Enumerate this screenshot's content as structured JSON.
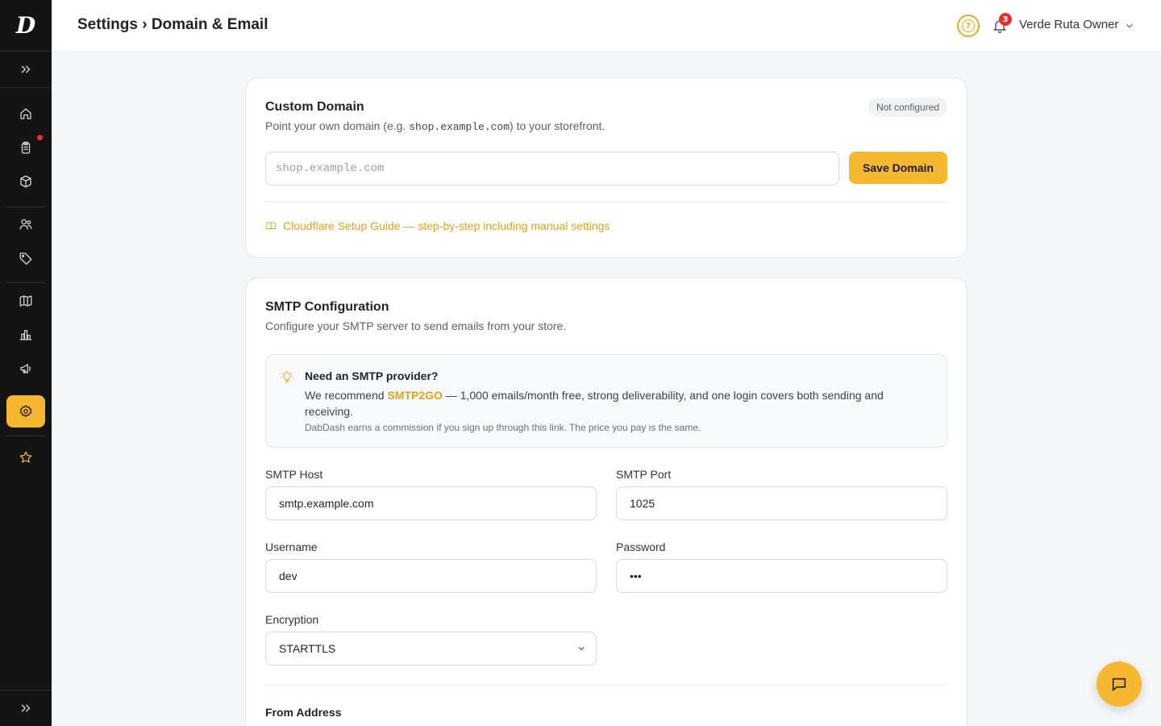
{
  "header": {
    "title": "Settings › Domain & Email",
    "user_name": "Verde Ruta Owner",
    "notification_count": "3"
  },
  "sidebar": {
    "items": [
      {
        "icon": "expand-icon"
      },
      {
        "icon": "home-icon"
      },
      {
        "icon": "orders-icon",
        "has_dot": true
      },
      {
        "icon": "box-icon"
      },
      {
        "icon": "customers-icon"
      },
      {
        "icon": "tag-icon"
      },
      {
        "icon": "book-icon"
      },
      {
        "icon": "analytics-icon"
      },
      {
        "icon": "megaphone-icon"
      },
      {
        "icon": "gear-icon",
        "active": true
      },
      {
        "icon": "star-icon"
      },
      {
        "icon": "collapse-icon"
      }
    ]
  },
  "custom_domain": {
    "title": "Custom Domain",
    "subtitle_before": "Point your own domain (e.g. ",
    "subtitle_code": "shop.example.com",
    "subtitle_after": ") to your storefront.",
    "status": "Not configured",
    "input_placeholder": "shop.example.com",
    "save_label": "Save Domain",
    "guide_link": "Cloudflare Setup Guide — step-by-step including manual settings"
  },
  "smtp": {
    "title": "SMTP Configuration",
    "subtitle": "Configure your SMTP server to send emails from your store.",
    "tip": {
      "title": "Need an SMTP provider?",
      "body_before": "We recommend ",
      "provider_link": "SMTP2GO",
      "body_after": " — 1,000 emails/month free, strong deliverability, and one login covers both sending and receiving.",
      "note": "DabDash earns a commission if you sign up through this link. The price you pay is the same."
    },
    "host_label": "SMTP Host",
    "host_value": "smtp.example.com",
    "port_label": "SMTP Port",
    "port_value": "1025",
    "username_label": "Username",
    "username_value": "dev",
    "password_label": "Password",
    "password_value": "•••",
    "encryption_label": "Encryption",
    "encryption_value": "STARTTLS",
    "from_section": "From Address"
  },
  "colors": {
    "accent": "#f6b731",
    "link": "#e0a21c",
    "sidebar_bg": "#141414",
    "badge": "#e5312e"
  }
}
